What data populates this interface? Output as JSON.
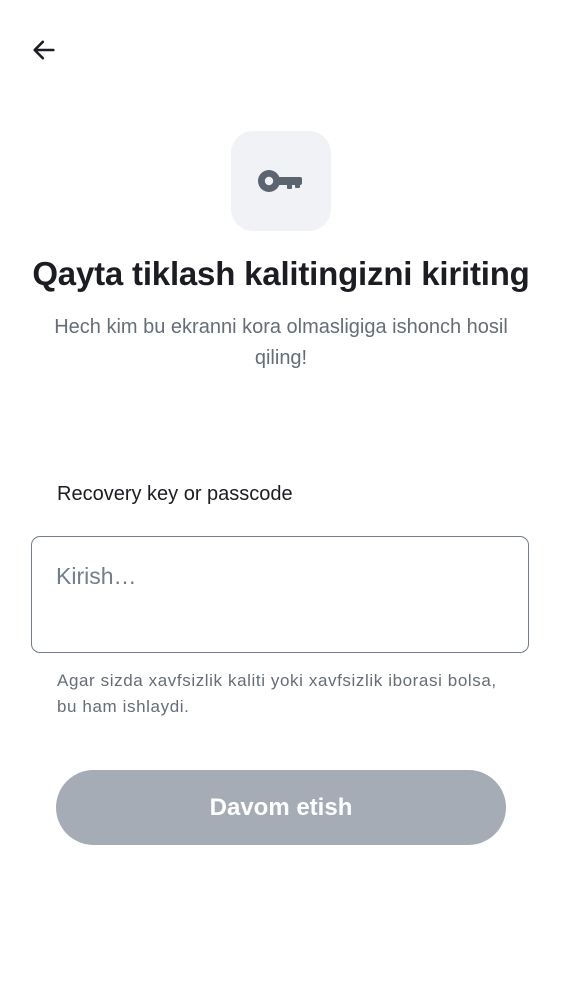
{
  "header": {
    "back_icon": "arrow-left-icon"
  },
  "hero": {
    "icon": "key-icon",
    "title": "Qayta tiklash kalitingizni kiriting",
    "subtitle": "Hech kim bu ekranni kora olmasligiga ishonch hosil qiling!"
  },
  "form": {
    "label": "Recovery key or passcode",
    "input_value": "",
    "input_placeholder": "Kirish…",
    "helper": "Agar sizda xavfsizlik kaliti yoki xavfsizlik iborasi bolsa, bu ham ishlaydi."
  },
  "actions": {
    "continue_label": "Davom etish",
    "continue_enabled": false
  },
  "colors": {
    "text_primary": "#1b1d22",
    "text_secondary": "#656d77",
    "icon_tile_bg": "#f0f2f5",
    "button_disabled_bg": "#a6acb5",
    "input_border": "#737d8c"
  }
}
